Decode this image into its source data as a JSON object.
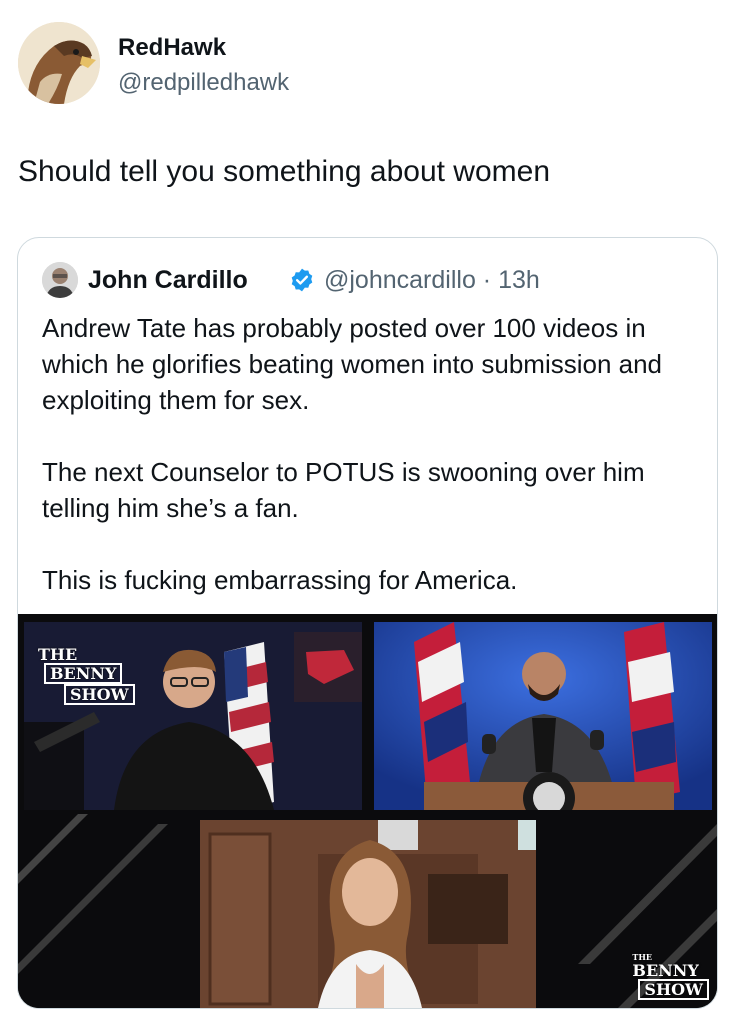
{
  "post": {
    "author_name": "RedHawk",
    "author_handle": "@redpilledhawk",
    "text": "Should tell you something about women"
  },
  "quoted": {
    "name": "John Cardillo",
    "handle": "@johncardillo",
    "separator": "·",
    "time": "13h",
    "paragraphs": [
      "Andrew Tate has probably posted over 100 videos in which he glorifies beating women into submission and exploiting them for sex.",
      "The next Counselor to POTUS is swooning over him telling him she’s a fan.",
      "This is fucking embarrassing for America."
    ]
  },
  "media": {
    "watermark_top_left": [
      "THE",
      "BENNY",
      "SHOW"
    ],
    "watermark_bottom_right": [
      "THE",
      "BENNY",
      "SHOW"
    ]
  },
  "colors": {
    "verified": "#1d9bf0",
    "handle": "#536471",
    "border": "#cfd9de"
  },
  "icons": {
    "verified": "verified-badge-icon",
    "avatar": "hawk-avatar"
  }
}
